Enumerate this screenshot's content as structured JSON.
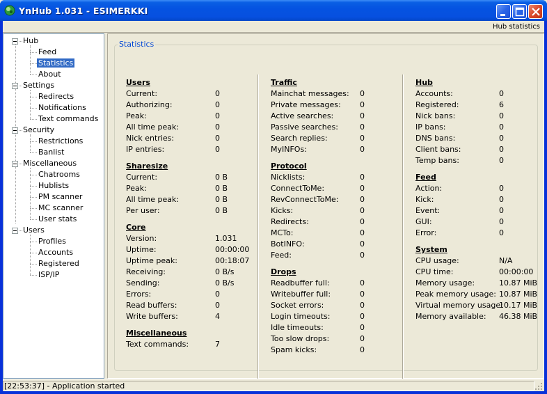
{
  "window": {
    "title": "YnHub 1.031 - ESIMERKKI",
    "controls": {
      "minimize": "minimize",
      "maximize": "maximize",
      "close": "close"
    }
  },
  "toolbar": {
    "right_label": "Hub statistics"
  },
  "tree": {
    "groups": [
      {
        "label": "Hub",
        "children": [
          "Feed",
          "Statistics",
          "About"
        ]
      },
      {
        "label": "Settings",
        "children": [
          "Redirects",
          "Notifications",
          "Text commands"
        ]
      },
      {
        "label": "Security",
        "children": [
          "Restrictions",
          "Banlist"
        ]
      },
      {
        "label": "Miscellaneous",
        "children": [
          "Chatrooms",
          "Hublists",
          "PM scanner",
          "MC scanner",
          "User stats"
        ]
      },
      {
        "label": "Users",
        "children": [
          "Profiles",
          "Accounts",
          "Registered",
          "ISP/IP"
        ]
      }
    ],
    "selected": "Statistics"
  },
  "statistics": {
    "group_title": "Statistics",
    "columns": [
      {
        "sections": [
          {
            "title": "Users",
            "rows": [
              [
                "Current:",
                "0"
              ],
              [
                "Authorizing:",
                "0"
              ],
              [
                "Peak:",
                "0"
              ],
              [
                "All time peak:",
                "0"
              ],
              [
                "Nick entries:",
                "0"
              ],
              [
                "IP entries:",
                "0"
              ]
            ]
          },
          {
            "title": "Sharesize",
            "rows": [
              [
                "Current:",
                "0 B"
              ],
              [
                "Peak:",
                "0 B"
              ],
              [
                "All time peak:",
                "0 B"
              ],
              [
                "Per user:",
                "0 B"
              ]
            ]
          },
          {
            "title": "Core",
            "rows": [
              [
                "Version:",
                "1.031"
              ],
              [
                "Uptime:",
                "00:00:00"
              ],
              [
                "Uptime peak:",
                "00:18:07"
              ],
              [
                "Receiving:",
                "0 B/s"
              ],
              [
                "Sending:",
                "0 B/s"
              ],
              [
                "Errors:",
                "0"
              ],
              [
                "Read buffers:",
                "0"
              ],
              [
                "Write buffers:",
                "4"
              ]
            ]
          },
          {
            "title": "Miscellaneous",
            "rows": [
              [
                "Text commands:",
                "7"
              ]
            ]
          }
        ]
      },
      {
        "sections": [
          {
            "title": "Traffic",
            "rows": [
              [
                "Mainchat messages:",
                "0"
              ],
              [
                "Private messages:",
                "0"
              ],
              [
                "Active searches:",
                "0"
              ],
              [
                "Passive searches:",
                "0"
              ],
              [
                "Search replies:",
                "0"
              ],
              [
                "MyINFOs:",
                "0"
              ]
            ]
          },
          {
            "title": "Protocol",
            "rows": [
              [
                "Nicklists:",
                "0"
              ],
              [
                "ConnectToMe:",
                "0"
              ],
              [
                "RevConnectToMe:",
                "0"
              ],
              [
                "Kicks:",
                "0"
              ],
              [
                "Redirects:",
                "0"
              ],
              [
                "MCTo:",
                "0"
              ],
              [
                "BotINFO:",
                "0"
              ],
              [
                "Feed:",
                "0"
              ]
            ]
          },
          {
            "title": "Drops",
            "rows": [
              [
                "Readbuffer full:",
                "0"
              ],
              [
                "Writebuffer full:",
                "0"
              ],
              [
                "Socket errors:",
                "0"
              ],
              [
                "Login timeouts:",
                "0"
              ],
              [
                "Idle timeouts:",
                "0"
              ],
              [
                "Too slow drops:",
                "0"
              ],
              [
                "Spam kicks:",
                "0"
              ]
            ]
          }
        ]
      },
      {
        "sections": [
          {
            "title": "Hub",
            "rows": [
              [
                "Accounts:",
                "0"
              ],
              [
                "Registered:",
                "6"
              ],
              [
                "Nick bans:",
                "0"
              ],
              [
                "IP bans:",
                "0"
              ],
              [
                "DNS bans:",
                "0"
              ],
              [
                "Client bans:",
                "0"
              ],
              [
                "Temp bans:",
                "0"
              ]
            ]
          },
          {
            "title": "Feed",
            "rows": [
              [
                "Action:",
                "0"
              ],
              [
                "Kick:",
                "0"
              ],
              [
                "Event:",
                "0"
              ],
              [
                "GUI:",
                "0"
              ],
              [
                "Error:",
                "0"
              ]
            ]
          },
          {
            "title": "System",
            "rows": [
              [
                "CPU usage:",
                "N/A"
              ],
              [
                "CPU time:",
                "00:00:00"
              ],
              [
                "Memory usage:",
                "10.87 MiB"
              ],
              [
                "Peak memory usage:",
                "10.87 MiB"
              ],
              [
                "Virtual memory usage:",
                "10.17 MiB"
              ],
              [
                "Memory available:",
                "46.38 MiB"
              ]
            ]
          }
        ]
      }
    ]
  },
  "status": {
    "text": "[22:53:37] - Application started"
  }
}
